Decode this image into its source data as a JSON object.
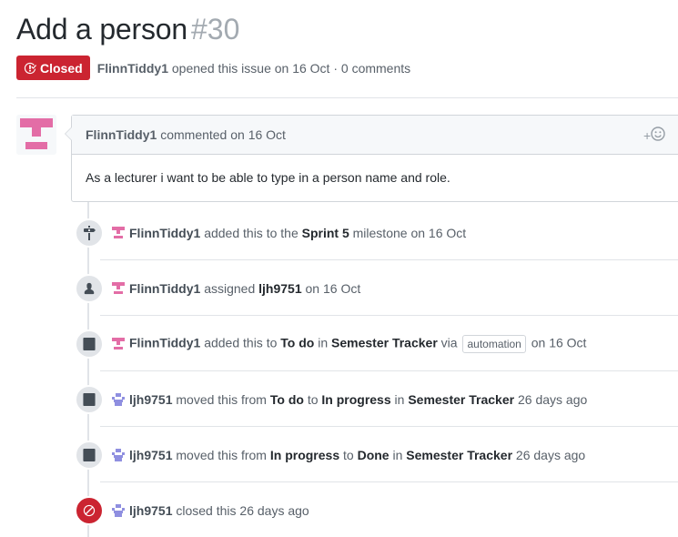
{
  "issue": {
    "title": "Add a person",
    "number": "#30",
    "state": "Closed",
    "author": "FlinnTiddy1",
    "meta_rest": "opened this issue on 16 Oct · 0 comments"
  },
  "comment": {
    "author": "FlinnTiddy1",
    "header_rest": "commented on 16 Oct",
    "reaction_plus": "+",
    "body": "As a lecturer i want to be able to type in a person name and role."
  },
  "events": [
    {
      "icon": "milestone-icon",
      "user": "FlinnTiddy1",
      "t1": "added this to the",
      "s1": "Sprint 5",
      "t2": "milestone on 16 Oct"
    },
    {
      "icon": "person-icon",
      "user": "FlinnTiddy1",
      "t1": "assigned",
      "s1": "ljh9751",
      "t2": "on 16 Oct"
    },
    {
      "icon": "project-icon",
      "user": "FlinnTiddy1",
      "t1": "added this to",
      "s1": "To do",
      "t2": "in",
      "s2": "Semester Tracker",
      "t3": "via",
      "label": "automation",
      "t4": "on 16 Oct"
    },
    {
      "icon": "project-icon",
      "user": "ljh9751",
      "t1": "moved this from",
      "s1": "To do",
      "t2": "to",
      "s2": "In progress",
      "t3": "in",
      "s3": "Semester Tracker",
      "t4": "26 days ago"
    },
    {
      "icon": "project-icon",
      "user": "ljh9751",
      "t1": "moved this from",
      "s1": "In progress",
      "t2": "to",
      "s2": "Done",
      "t3": "in",
      "s3": "Semester Tracker",
      "t4": "26 days ago"
    },
    {
      "icon": "circle-slash-icon",
      "user": "ljh9751",
      "t1": "closed this 26 days ago"
    }
  ],
  "colors": {
    "closed_red": "#cb2431",
    "avatar_pink": "#e36da6",
    "avatar_purple": "#8f8fe0"
  }
}
